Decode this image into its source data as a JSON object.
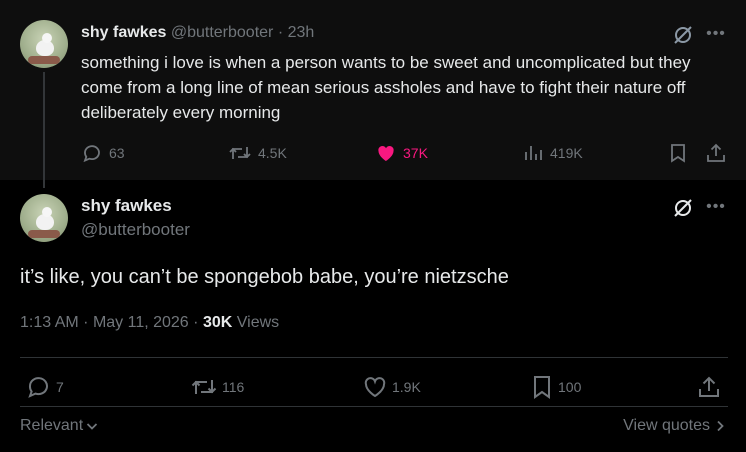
{
  "parent": {
    "name": "shy fawkes",
    "handle": "@butterbooter",
    "separator": "·",
    "time": "23h",
    "text": "something i love is when a person wants to be sweet and uncomplicated but they come from a long line of mean serious assholes and have to fight their nature off deliberately every morning",
    "stats": {
      "replies": "63",
      "reposts": "4.5K",
      "likes": "37K",
      "views": "419K"
    },
    "liked": true
  },
  "main": {
    "name": "shy fawkes",
    "handle": "@butterbooter",
    "text": "it’s like, you can’t be spongebob babe, you’re nietzsche",
    "time": "1:13 AM",
    "dot1": "·",
    "date": "May 11, 2026",
    "dot2": "·",
    "views_count": "30K",
    "views_label": "Views",
    "stats": {
      "replies": "7",
      "reposts": "116",
      "likes": "1.9K",
      "bookmarks": "100"
    }
  },
  "footer": {
    "sort_label": "Relevant",
    "view_quotes_label": "View quotes"
  },
  "colors": {
    "background": "#000000",
    "parent_background": "#0e0e0e",
    "text": "#e7e9ea",
    "muted": "#71767b",
    "like_active": "#f91880",
    "divider": "#2f3336"
  },
  "icons": [
    "grok-icon",
    "more-icon",
    "reply-icon",
    "repost-icon",
    "like-icon",
    "views-icon",
    "bookmark-icon",
    "share-icon",
    "chevron-down-icon",
    "chevron-right-icon"
  ]
}
